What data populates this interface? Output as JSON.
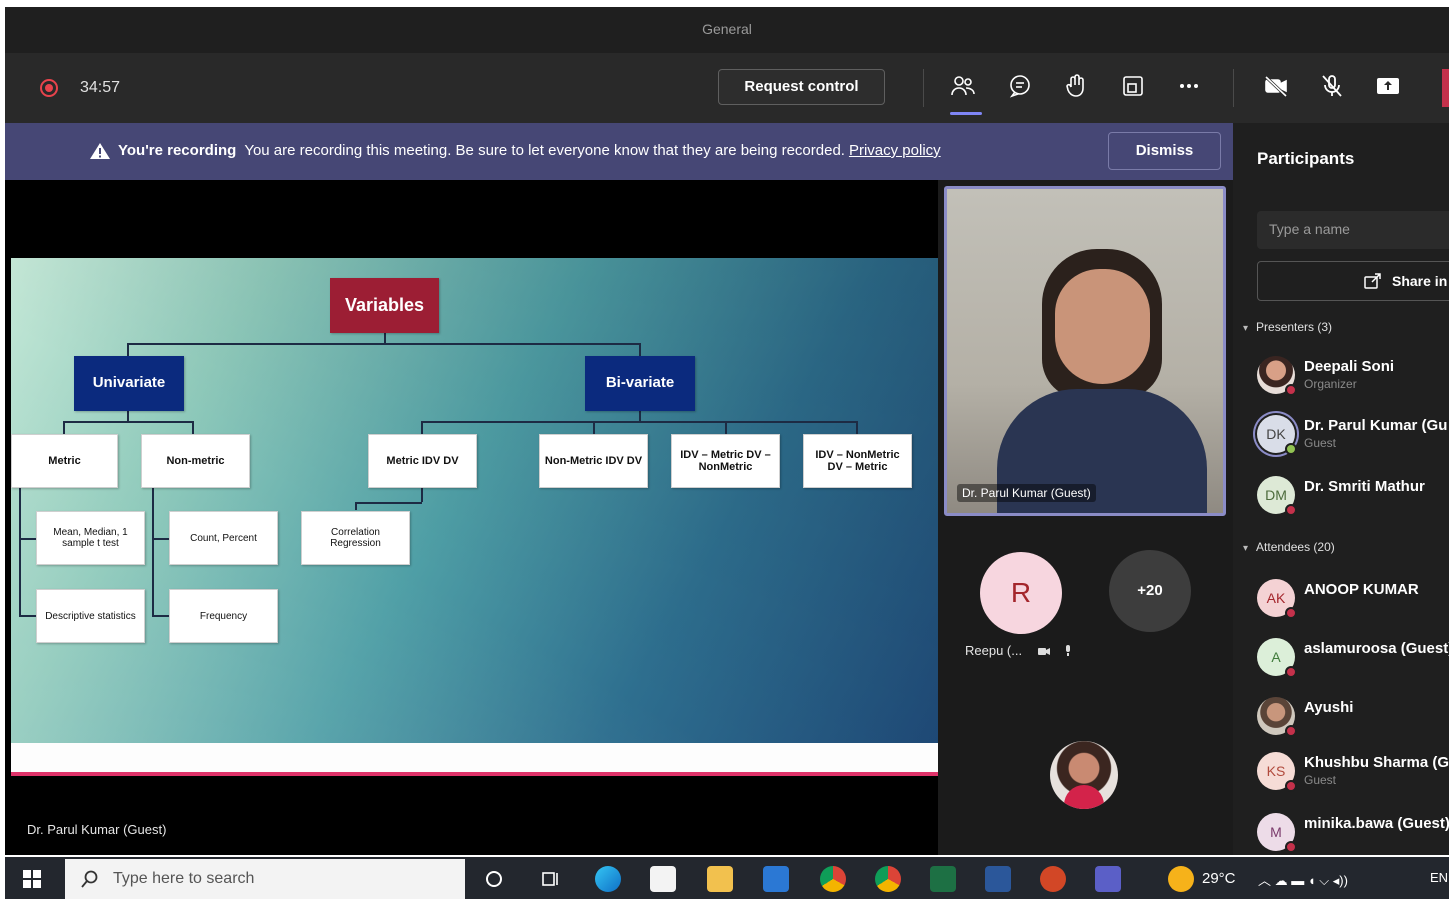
{
  "window": {
    "title": "General"
  },
  "toolbar": {
    "timer": "34:57",
    "request_control": "Request control",
    "colors": {
      "accent": "#7f85f5",
      "record": "#e8434c",
      "leave": "#c4314b"
    }
  },
  "banner": {
    "title": "You're recording",
    "message": "You are recording this meeting. Be sure to let everyone know that they are being recorded.",
    "link": "Privacy policy",
    "dismiss": "Dismiss"
  },
  "stage": {
    "presenter_label": "Dr. Parul Kumar (Guest)",
    "slide": {
      "root": "Variables",
      "univariate": "Univariate",
      "bivariate": "Bi-variate",
      "metric": "Metric",
      "non_metric": "Non-metric",
      "mean_median": "Mean, Median, 1 sample t test",
      "descriptive": "Descriptive statistics",
      "count_percent": "Count, Percent",
      "frequency": "Frequency",
      "metric_idv_dv": "Metric IDV DV",
      "correlation": "Correlation Regression",
      "nonmetric_idv_dv": "Non-Metric IDV DV",
      "idv_metric_dv_nonmetric": "IDV – Metric DV – NonMetric",
      "idv_nonmetric_dv_metric": "IDV – NonMetric DV – Metric"
    }
  },
  "gallery": {
    "video_name": "Dr. Parul Kumar (Guest)",
    "tile_initial": "R",
    "tile_name": "Reepu (...",
    "overflow": "+20"
  },
  "participants": {
    "title": "Participants",
    "search_placeholder": "Type a name",
    "share_label": "Share in",
    "presenters_header": "Presenters (3)",
    "attendees_header": "Attendees (20)",
    "presenters": [
      {
        "initials": "",
        "name": "Deepali Soni",
        "role": "Organizer"
      },
      {
        "initials": "DK",
        "name": "Dr. Parul Kumar (Gu",
        "role": "Guest"
      },
      {
        "initials": "DM",
        "name": "Dr. Smriti Mathur",
        "role": ""
      }
    ],
    "attendees": [
      {
        "initials": "AK",
        "name": "ANOOP KUMAR",
        "role": ""
      },
      {
        "initials": "A",
        "name": "aslamuroosa (Guest)",
        "role": ""
      },
      {
        "initials": "",
        "name": "Ayushi",
        "role": ""
      },
      {
        "initials": "KS",
        "name": "Khushbu Sharma (G",
        "role": "Guest"
      },
      {
        "initials": "M",
        "name": "minika.bawa (Guest)",
        "role": ""
      }
    ]
  },
  "taskbar": {
    "search_placeholder": "Type here to search",
    "weather": "29°C",
    "lang": "EN"
  }
}
